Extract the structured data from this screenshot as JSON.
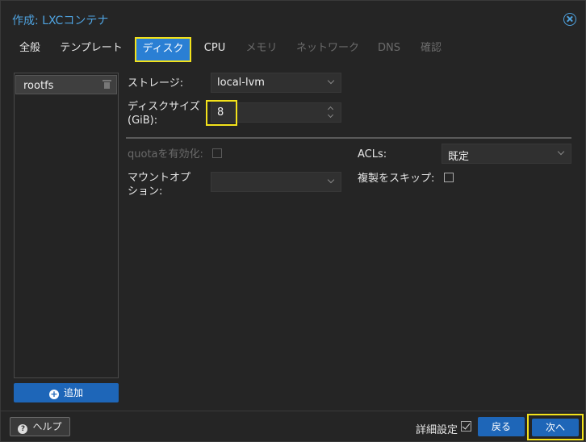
{
  "window": {
    "title": "作成: LXCコンテナ"
  },
  "tabs": [
    {
      "label": "全般",
      "state": "normal"
    },
    {
      "label": "テンプレート",
      "state": "normal"
    },
    {
      "label": "ディスク",
      "state": "active"
    },
    {
      "label": "CPU",
      "state": "normal"
    },
    {
      "label": "メモリ",
      "state": "disabled"
    },
    {
      "label": "ネットワーク",
      "state": "disabled"
    },
    {
      "label": "DNS",
      "state": "disabled"
    },
    {
      "label": "確認",
      "state": "disabled"
    }
  ],
  "sidebar": {
    "items": [
      {
        "label": "rootfs"
      }
    ],
    "add_label": "追加"
  },
  "form": {
    "storage_label": "ストレージ:",
    "storage_value": "local-lvm",
    "disk_size_label_line1": "ディスクサイズ",
    "disk_size_label_line2": "(GiB):",
    "disk_size_value": "8",
    "quota_label": "quotaを有効化:",
    "quota_checked": false,
    "acls_label": "ACLs:",
    "acls_value": "既定",
    "mount_label_line1": "マウントオプ",
    "mount_label_line2": "ション:",
    "mount_value": "",
    "skip_replication_label": "複製をスキップ:",
    "skip_replication_checked": false
  },
  "footer": {
    "help_label": "ヘルプ",
    "advanced_label": "詳細設定",
    "advanced_checked": true,
    "back_label": "戻る",
    "next_label": "次へ"
  },
  "colors": {
    "accent": "#2a7fd4",
    "button": "#1e66b8",
    "highlight": "#f3e21b",
    "title": "#4fa3e0"
  }
}
